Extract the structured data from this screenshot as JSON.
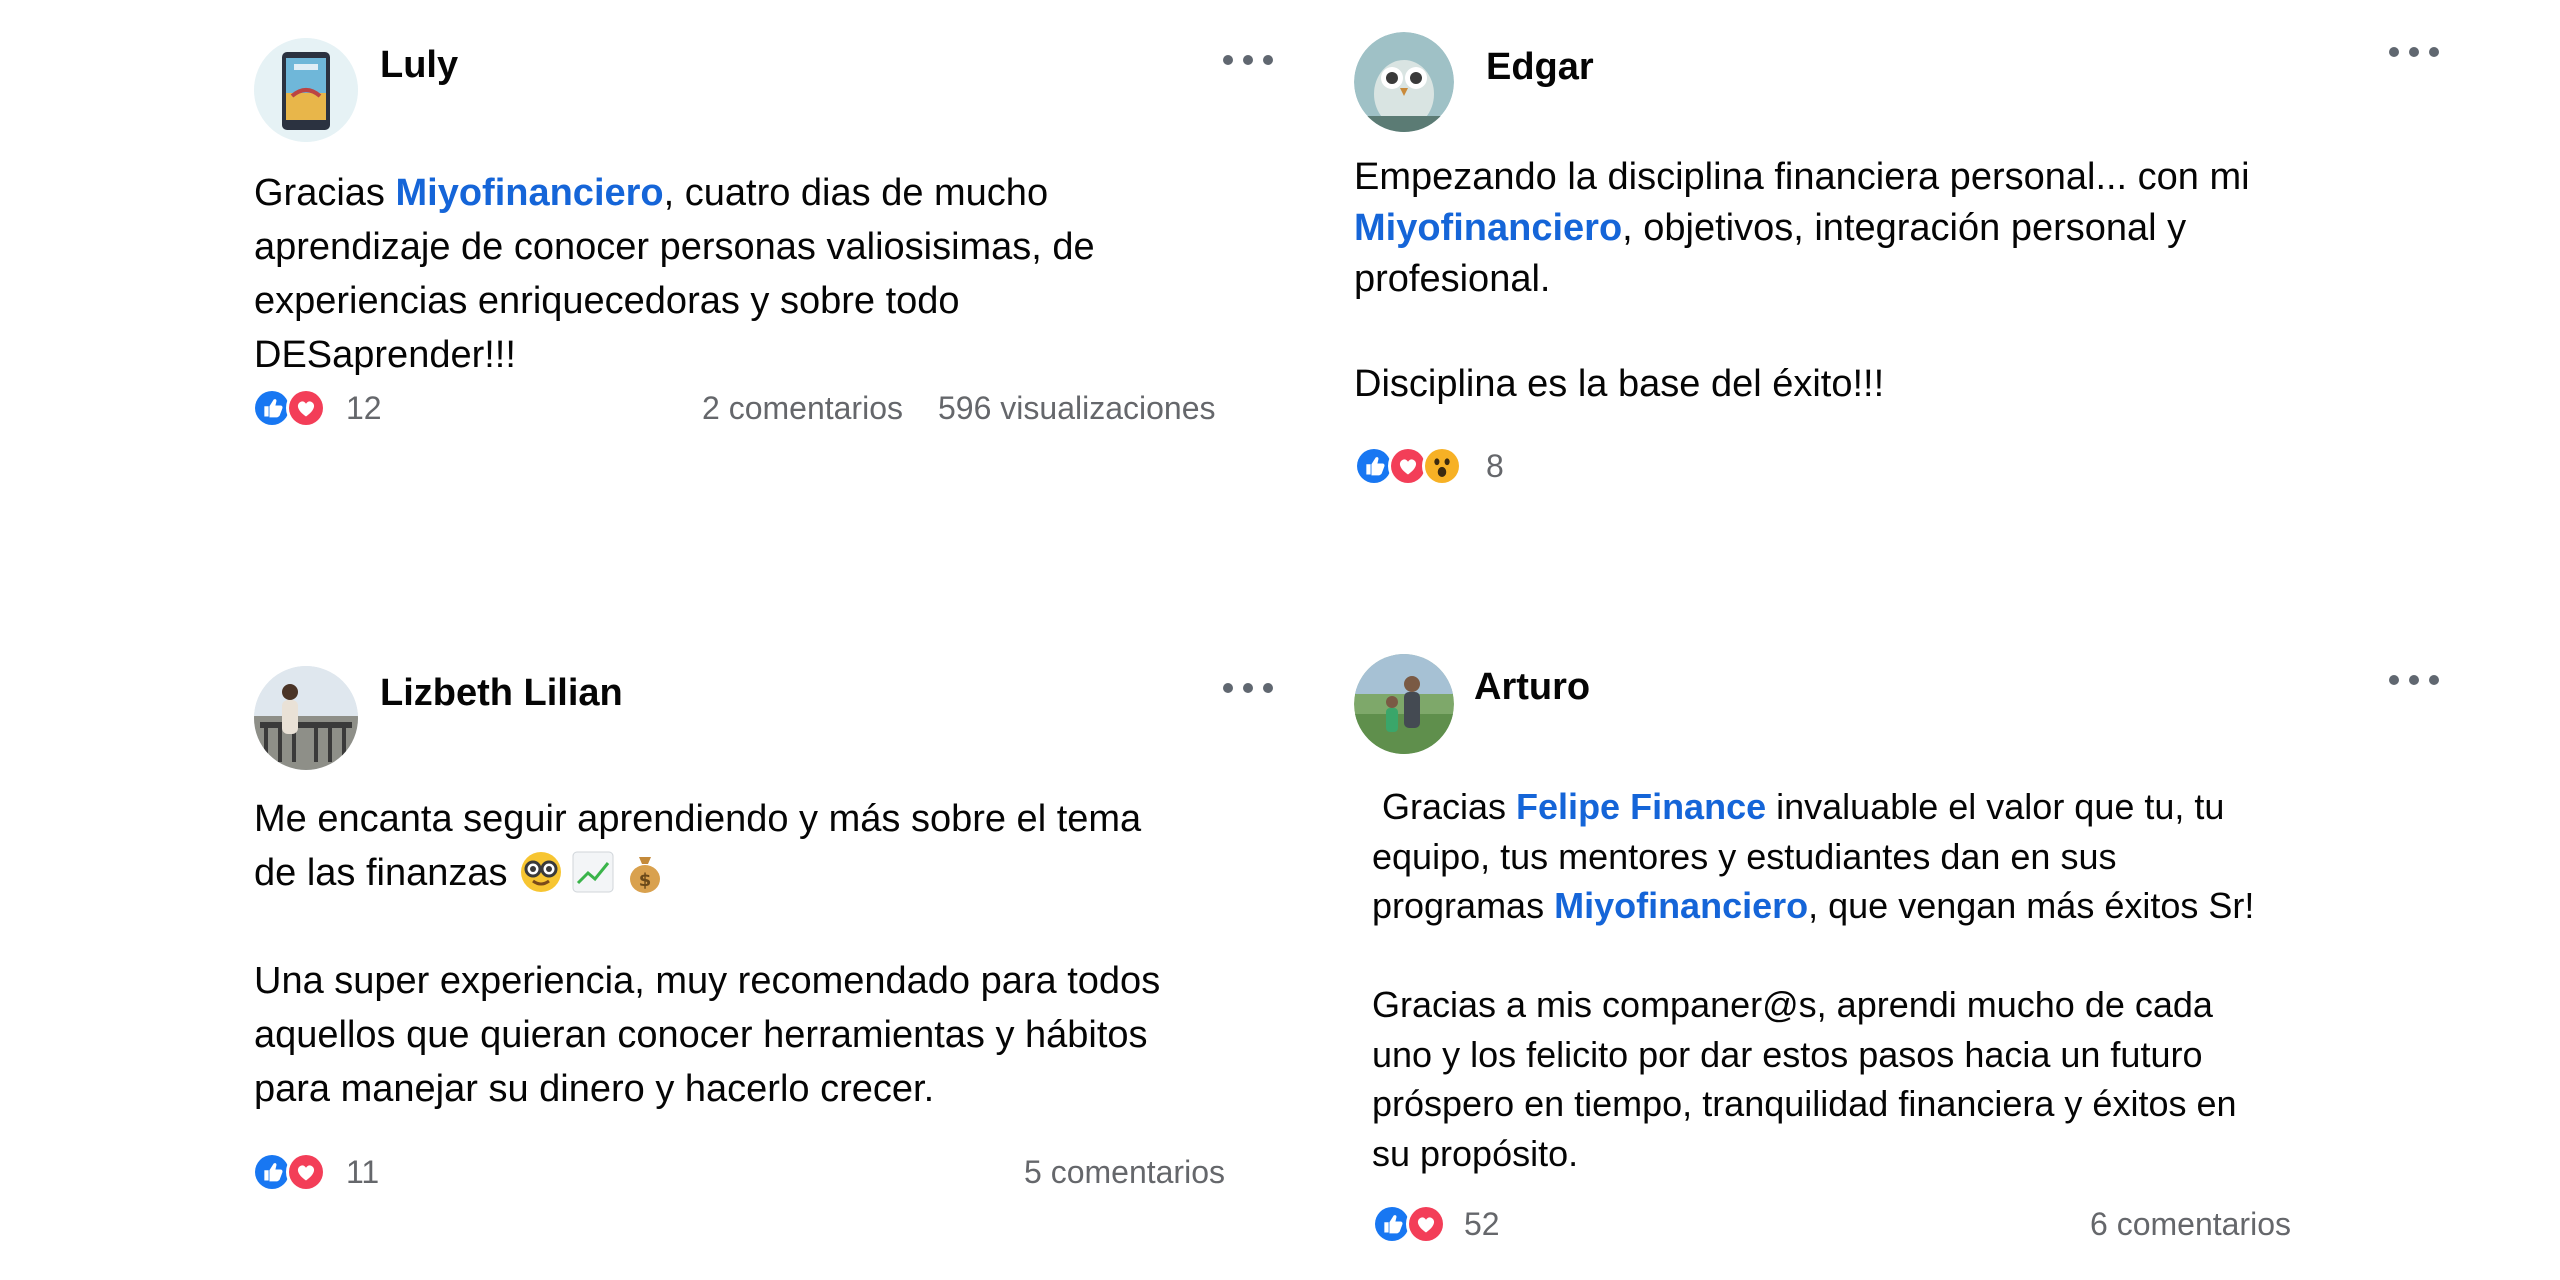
{
  "posts": [
    {
      "author": "Luly",
      "text": {
        "p1_before": "Gracias ",
        "p1_mention": "Miyofinanciero",
        "p1_after": ", cuatro dias de mucho",
        "p1_line2": "aprendizaje de conocer personas valiosisimas, de",
        "p1_line3": "experiencias enriquecedoras y sobre todo",
        "p1_line4": "DESaprender!!!"
      },
      "reactions_count": "12",
      "comments": "2 comentarios",
      "views": "596 visualizaciones",
      "reaction_icons": [
        "like-icon",
        "love-icon"
      ]
    },
    {
      "author": "Edgar",
      "text": {
        "line1": "Empezando la disciplina financiera personal... con mi",
        "line2_mention": "Miyofinanciero",
        "line2_after": ", objetivos, integración personal y",
        "line3": "profesional.",
        "line4": "Disciplina es la base del éxito!!!"
      },
      "reactions_count": "8",
      "reaction_icons": [
        "like-icon",
        "love-icon",
        "wow-icon"
      ]
    },
    {
      "author": "Lizbeth Lilian",
      "text": {
        "line1": "Me encanta seguir aprendiendo y más sobre el tema",
        "line2": "de las finanzas",
        "line3": "Una super experiencia, muy recomendado para todos",
        "line4": "aquellos que quieran conocer herramientas y hábitos",
        "line5": "para manejar su dinero y hacerlo crecer."
      },
      "inline_emojis": [
        "nerd-face-icon",
        "chart-increasing-icon",
        "money-bag-icon"
      ],
      "reactions_count": "11",
      "comments": "5 comentarios",
      "reaction_icons": [
        "like-icon",
        "love-icon"
      ]
    },
    {
      "author": "Arturo",
      "text": {
        "line1_before": " Gracias ",
        "line1_mention": "Felipe Finance",
        "line1_after": " invaluable el valor que tu, tu",
        "line2": "equipo, tus mentores y estudiantes dan en sus",
        "line3_before": "programas ",
        "line3_mention": "Miyofinanciero",
        "line3_after": ", que vengan más éxitos Sr!",
        "line4": "Gracias a mis companer@s, aprendi mucho de cada",
        "line5": "uno y los felicito por dar estos pasos hacia un futuro",
        "line6": "próspero en tiempo, tranquilidad financiera y éxitos en",
        "line7": "su propósito."
      },
      "reactions_count": "52",
      "comments": "6 comentarios",
      "reaction_icons": [
        "like-icon",
        "love-icon"
      ]
    }
  ],
  "colors": {
    "mention": "#1565d8",
    "muted": "#65676b",
    "like_blue": "#1877f2",
    "love_red": "#f33e58",
    "wow_yellow": "#f7b125"
  }
}
